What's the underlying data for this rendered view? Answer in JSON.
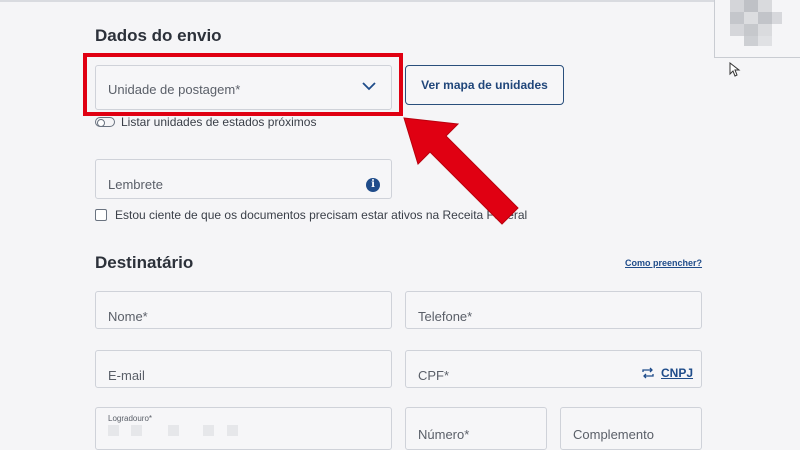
{
  "shipping": {
    "title": "Dados do envio",
    "unit_select": {
      "placeholder": "Unidade de postagem*"
    },
    "map_button": "Ver mapa de unidades",
    "toggle_label": "Listar unidades de estados próximos",
    "reminder_field": {
      "placeholder": "Lembrete"
    },
    "info_icon_glyph": "i",
    "checkbox_label": "Estou ciente de que os documentos precisam estar ativos na Receita Federal"
  },
  "recipient": {
    "title": "Destinatário",
    "help_link": "Como preencher?",
    "fields": {
      "name": "Nome*",
      "phone": "Telefone*",
      "email": "E-mail",
      "cpf": "CPF*",
      "cpf_switch": "CNPJ",
      "street": "Logradouro*",
      "number": "Número*",
      "complement": "Complemento"
    }
  },
  "annotation": {
    "highlight_color": "#e00012",
    "arrow_color": "#e00012"
  },
  "colors": {
    "accent": "#1f4c8a",
    "background": "#f5f5f7",
    "border": "#cfd2d9"
  }
}
